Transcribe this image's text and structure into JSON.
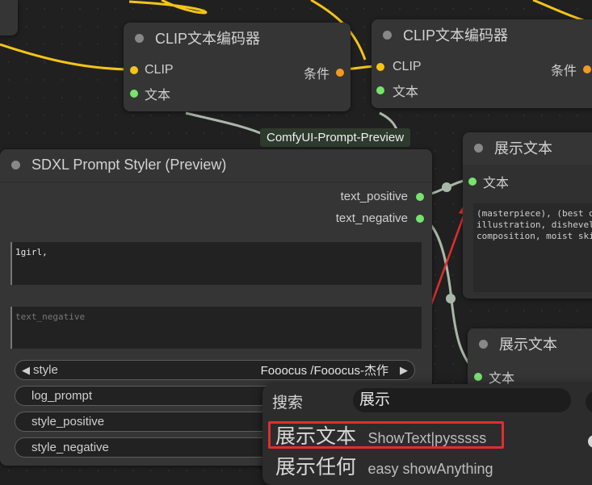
{
  "canvas": {
    "clip_node_1": {
      "title": "CLIP文本编码器",
      "input_clip": "CLIP",
      "input_text": "文本",
      "output": "条件"
    },
    "clip_node_2": {
      "title": "CLIP文本编码器",
      "input_clip": "CLIP",
      "input_text": "文本",
      "output": "条件"
    },
    "group_label": "ComfyUI-Prompt-Preview",
    "show_text_node_1": {
      "title": "展示文本",
      "input_text": "文本",
      "content_lines": [
        "(masterpiece), (best q",
        "illustration, dishevel",
        "composition, moist ski"
      ]
    },
    "show_text_node_2": {
      "title": "展示文本",
      "input_text": "文本"
    },
    "styler_node": {
      "title": "SDXL Prompt Styler (Preview)",
      "output_positive": "text_positive",
      "output_negative": "text_negative",
      "positive_text": "1girl,",
      "negative_placeholder": "text_negative",
      "style_label": "style",
      "style_value": "Fooocus /Fooocus-杰作",
      "widgets": [
        "log_prompt",
        "style_positive",
        "style_negative"
      ]
    }
  },
  "search_dialog": {
    "label": "搜索",
    "query": "展示",
    "results": [
      {
        "cn": "展示文本",
        "en": "ShowText|pysssss"
      },
      {
        "cn": "展示任何",
        "en": "easy showAnything"
      }
    ]
  },
  "colors": {
    "clip_wire": "#f4c417",
    "string_wire": "#a9b7a9",
    "annotation": "#e02e2e"
  }
}
